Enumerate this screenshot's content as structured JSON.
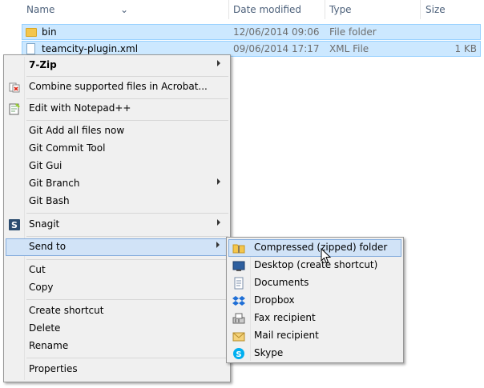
{
  "header": {
    "name": "Name",
    "date_modified": "Date modified",
    "type": "Type",
    "size": "Size"
  },
  "files": [
    {
      "name": "bin",
      "date": "12/06/2014 09:06",
      "type": "File folder",
      "size": "",
      "icon": "folder-icon"
    },
    {
      "name": "teamcity-plugin.xml",
      "date": "09/06/2014 17:17",
      "type": "XML File",
      "size": "1 KB",
      "icon": "xml-file-icon"
    }
  ],
  "context_menu": {
    "items": [
      {
        "label": "7-Zip",
        "bold": true,
        "submenu": true
      },
      {
        "label": "Combine supported files in Acrobat...",
        "icon": "acrobat-icon"
      },
      {
        "label": "Edit with Notepad++",
        "icon": "notepad-plus-icon"
      },
      {
        "label": "Git Add all files now"
      },
      {
        "label": "Git Commit Tool"
      },
      {
        "label": "Git Gui"
      },
      {
        "label": "Git Branch",
        "submenu": true
      },
      {
        "label": "Git Bash"
      },
      {
        "label": "Snagit",
        "icon": "snagit-icon",
        "submenu": true
      },
      {
        "label": "Send to",
        "submenu": true,
        "highlighted": true
      },
      {
        "label": "Cut"
      },
      {
        "label": "Copy"
      },
      {
        "label": "Create shortcut"
      },
      {
        "label": "Delete"
      },
      {
        "label": "Rename"
      },
      {
        "label": "Properties"
      }
    ]
  },
  "send_to_menu": {
    "items": [
      {
        "label": "Compressed (zipped) folder",
        "icon": "zip-folder-icon",
        "highlighted": true
      },
      {
        "label": "Desktop (create shortcut)",
        "icon": "desktop-icon"
      },
      {
        "label": "Documents",
        "icon": "documents-icon"
      },
      {
        "label": "Dropbox",
        "icon": "dropbox-icon"
      },
      {
        "label": "Fax recipient",
        "icon": "fax-icon"
      },
      {
        "label": "Mail recipient",
        "icon": "mail-icon"
      },
      {
        "label": "Skype",
        "icon": "skype-icon"
      }
    ]
  },
  "colors": {
    "selection": "#cce8ff",
    "menu_bg": "#f0f0f0",
    "menu_highlight": "#d1e3f7"
  }
}
